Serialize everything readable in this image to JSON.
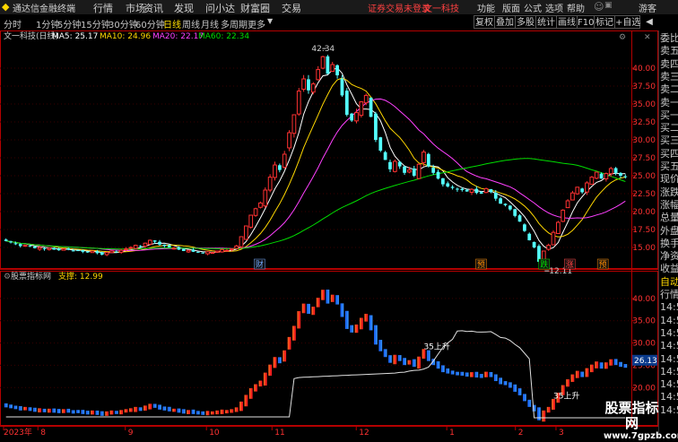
{
  "app": {
    "title": "通达信金融终端",
    "menu": [
      "行情",
      "市场",
      "资讯",
      "发现",
      "问小达",
      "财富圈",
      "交易"
    ],
    "notice": "证券交易未登录",
    "stock": "文一科技",
    "right_menu": [
      "功能",
      "版面",
      "公式",
      "选项",
      "帮助"
    ],
    "guest": "游客"
  },
  "toolbar": {
    "timeframes": [
      "分时",
      "1分钟",
      "5分钟",
      "15分钟",
      "30分钟",
      "60分钟",
      "日线",
      "周线",
      "月线",
      "多周期",
      "更多"
    ],
    "active": "日线",
    "tools": [
      "复权",
      "叠加",
      "多股",
      "统计",
      "画线",
      "F10",
      "标记",
      "+自选"
    ]
  },
  "right_panel": [
    "委比",
    "卖五",
    "卖四",
    "卖三",
    "卖二",
    "卖一",
    "买一",
    "买二",
    "买三",
    "买四",
    "买五",
    "现价",
    "涨跌",
    "涨幅",
    "总量",
    "外盘",
    "换手",
    "净资",
    "收益",
    "自动",
    "行情",
    "14:5",
    "14:5",
    "14:5",
    "14:5",
    "14:5",
    "14:5",
    "14:5",
    "14:5",
    "14:5"
  ],
  "colors": {
    "up": "#ff3232",
    "down": "#54ffff",
    "ma5": "#ffffff",
    "ma10": "#ffd700",
    "ma20": "#ff40ff",
    "ma60": "#00dd00",
    "axis": "#b40000"
  },
  "watermark": {
    "cn": "股票指标网",
    "url": "www.7gpzb.com"
  },
  "chart_data": [
    {
      "type": "candlestick",
      "title": "文一科技(日线)",
      "indicators": [
        {
          "name": "MA5",
          "value": "25.17",
          "color": "#ffffff"
        },
        {
          "name": "MA10",
          "value": "24.96",
          "color": "#ffd700"
        },
        {
          "name": "MA20",
          "value": "22.17",
          "color": "#ff40ff"
        },
        {
          "name": "MA60",
          "value": "22.34",
          "color": "#00dd00"
        }
      ],
      "y_ticks": [
        40.0,
        37.5,
        35.0,
        32.5,
        30.0,
        27.5,
        25.0,
        22.5,
        20.0,
        17.5,
        15.0
      ],
      "ylim": [
        12.5,
        43.5
      ],
      "x_ticks": [],
      "annotations": [
        {
          "text": "42.34",
          "type": "high"
        },
        {
          "text": "12.11",
          "type": "low"
        }
      ],
      "markers": [
        "财",
        "预",
        "跌",
        "涨",
        "预"
      ],
      "close": [
        15.9,
        15.7,
        15.5,
        15.2,
        15.3,
        15.1,
        14.9,
        15.0,
        14.8,
        14.9,
        14.7,
        14.6,
        14.8,
        14.7,
        14.5,
        14.6,
        14.4,
        14.3,
        14.5,
        14.2,
        14.0,
        14.3,
        14.5,
        14.4,
        14.6,
        14.8,
        15.0,
        15.3,
        15.1,
        15.6,
        16.0,
        15.8,
        15.4,
        15.2,
        15.0,
        14.9,
        14.7,
        14.5,
        14.6,
        14.4,
        14.3,
        14.2,
        14.4,
        14.3,
        14.5,
        14.7,
        14.6,
        14.8,
        15.2,
        16.5,
        18.0,
        19.5,
        20.4,
        21.2,
        23.0,
        24.8,
        26.5,
        25.8,
        28.0,
        31.0,
        33.5,
        36.8,
        38.5,
        36.9,
        37.8,
        39.8,
        41.6,
        39.2,
        40.5,
        39.0,
        36.2,
        33.5,
        32.7,
        33.8,
        35.3,
        36.2,
        33.2,
        30.0,
        28.5,
        27.2,
        25.9,
        27.0,
        26.3,
        25.4,
        25.8,
        25.0,
        26.6,
        28.3,
        26.3,
        25.4,
        24.6,
        23.8,
        23.5,
        23.3,
        23.1,
        23.0,
        22.8,
        23.1,
        22.6,
        22.5,
        23.2,
        22.7,
        21.8,
        21.1,
        20.9,
        20.3,
        19.4,
        18.6,
        17.3,
        16.0,
        15.0,
        13.0,
        14.5,
        15.3,
        17.1,
        18.5,
        20.2,
        21.5,
        22.6,
        23.4,
        22.7,
        24.0,
        24.8,
        25.5,
        24.6,
        25.3,
        26.0,
        25.4,
        25.0,
        24.8
      ]
    },
    {
      "type": "bar",
      "title": "股票指标网",
      "indicators": [
        {
          "name": "支撑",
          "value": "12.99"
        }
      ],
      "y_ticks": [
        40.0,
        35.0,
        30.0,
        25.0,
        20.0
      ],
      "ylim": [
        12.0,
        43.0
      ],
      "current_value": "26.13",
      "x_labels": [
        "2023年",
        "8",
        "9",
        "10",
        "11",
        "12",
        "1",
        "2",
        "3"
      ],
      "annotations": [
        "35上升",
        "35上升"
      ]
    }
  ]
}
